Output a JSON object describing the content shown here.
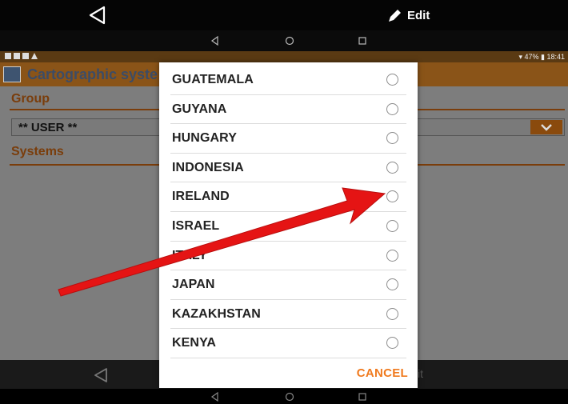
{
  "topbar": {
    "edit_label": "Edit"
  },
  "statusbar": {
    "battery": "47%",
    "time": "18:41"
  },
  "app": {
    "title": "Cartographic syste",
    "group_label": "Group",
    "group_value": "** USER **",
    "systems_label": "Systems",
    "bottom_edit_partial": "it"
  },
  "dialog": {
    "items": [
      "GUATEMALA",
      "GUYANA",
      "HUNGARY",
      "INDONESIA",
      "IRELAND",
      "ISRAEL",
      "ITALY",
      "JAPAN",
      "KAZAKHSTAN",
      "KENYA"
    ],
    "cancel_label": "CANCEL"
  },
  "colors": {
    "accent": "#f07a1e",
    "annotation_arrow": "#e51414"
  }
}
